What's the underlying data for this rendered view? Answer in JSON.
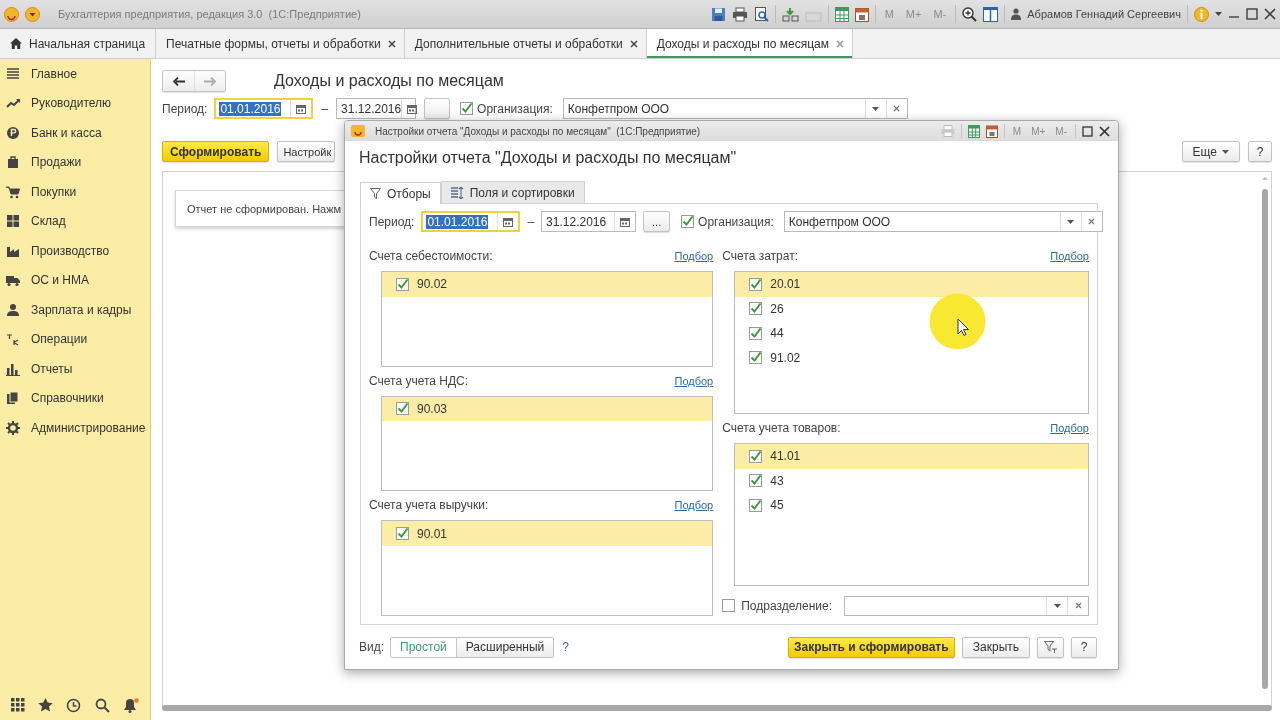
{
  "app": {
    "title": "Бухгалтерия предприятия, редакция 3.0  (1С:Предприятие)",
    "memory_buttons": [
      {
        "label": "M",
        "disabled": true
      },
      {
        "label": "M+",
        "disabled": true
      },
      {
        "label": "M-",
        "disabled": true
      }
    ],
    "user": "Абрамов Геннадий Сергеевич"
  },
  "tabs": [
    {
      "label": "Начальная страница",
      "kind": "home",
      "selected": false
    },
    {
      "label": "Печатные формы, отчеты и обработки",
      "kind": "document",
      "selected": false
    },
    {
      "label": "Дополнительные отчеты и обработки",
      "kind": "document",
      "selected": false
    },
    {
      "label": "Доходы и расходы по месяцам",
      "kind": "document",
      "selected": true
    }
  ],
  "sidebar": {
    "items": [
      "Главное",
      "Руководителю",
      "Банк и касса",
      "Продажи",
      "Покупки",
      "Склад",
      "Производство",
      "ОС и НМА",
      "Зарплата и кадры",
      "Операции",
      "Отчеты",
      "Справочники",
      "Администрирование"
    ]
  },
  "report": {
    "title": "Доходы и расходы по месяцам",
    "period_label": "Период:",
    "date_from": "01.01.2016",
    "dash": "–",
    "date_to": "31.12.2016",
    "org_checked": true,
    "org_label": "Организация:",
    "org_value": "Конфетпром ООО",
    "generate_button": "Сформировать",
    "settings_button": "Настройк",
    "more_button": "Еще",
    "help_button": "?",
    "message": "Отчет не сформирован. Нажм"
  },
  "dialog": {
    "window_title": "Настройки отчета \"Доходы и расходы по месяцам\"  (1С:Предприятие)",
    "memory_buttons": [
      {
        "label": "M",
        "disabled": true
      },
      {
        "label": "M+",
        "disabled": true
      },
      {
        "label": "M-",
        "disabled": true
      }
    ],
    "heading": "Настройки отчета \"Доходы и расходы по месяцам\"",
    "tabs": [
      {
        "label": "Отборы",
        "kind": "filter",
        "selected": true
      },
      {
        "label": "Поля и сортировки",
        "kind": "fields",
        "selected": false
      }
    ],
    "period_label": "Период:",
    "date_from": "01.01.2016",
    "dash": "–",
    "date_to": "31.12.2016",
    "ellipsis": "...",
    "org_checked": true,
    "org_label": "Организация:",
    "org_value": "Конфетпром ООО",
    "left_groups": [
      {
        "label": "Счета себестоимости:",
        "pick": "Подбор",
        "items": [
          {
            "code": "90.02",
            "checked": true,
            "selected": true
          }
        ]
      },
      {
        "label": "Счета учета НДС:",
        "pick": "Подбор",
        "items": [
          {
            "code": "90.03",
            "checked": true,
            "selected": true
          }
        ]
      },
      {
        "label": "Счета учета выручки:",
        "pick": "Подбор",
        "items": [
          {
            "code": "90.01",
            "checked": true,
            "selected": true
          }
        ]
      }
    ],
    "right_groups": [
      {
        "label": "Счета затрат:",
        "pick": "Подбор",
        "items": [
          {
            "code": "20.01",
            "checked": true,
            "selected": true
          },
          {
            "code": "26",
            "checked": true,
            "selected": false
          },
          {
            "code": "44",
            "checked": true,
            "selected": false
          },
          {
            "code": "91.02",
            "checked": true,
            "selected": false
          }
        ]
      },
      {
        "label": "Счета учета товаров:",
        "pick": "Подбор",
        "items": [
          {
            "code": "41.01",
            "checked": true,
            "selected": true
          },
          {
            "code": "43",
            "checked": true,
            "selected": false
          },
          {
            "code": "45",
            "checked": true,
            "selected": false
          }
        ]
      }
    ],
    "division": {
      "label": "Подразделение:",
      "checked": false
    },
    "view_label": "Вид:",
    "view_options": [
      {
        "label": "Простой",
        "selected": true
      },
      {
        "label": "Расширенный",
        "selected": false
      }
    ],
    "view_help": "?",
    "buttons": [
      {
        "label": "Закрыть и сформировать",
        "kind": "primary"
      },
      {
        "label": "Закрыть",
        "kind": "default"
      },
      {
        "kind": "filter"
      },
      {
        "label": "?",
        "kind": "default"
      }
    ]
  }
}
